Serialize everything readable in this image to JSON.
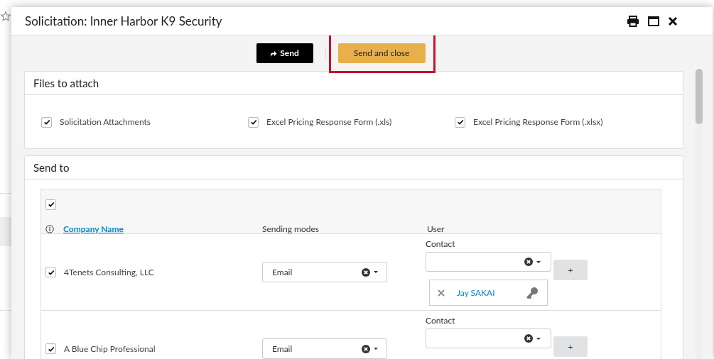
{
  "dialog": {
    "title": "Solicitation: Inner Harbor K9 Security",
    "toolbar": {
      "send": "Send",
      "send_and_close": "Send and close",
      "highlighted": true
    },
    "files_panel": {
      "title": "Files to attach",
      "items": [
        {
          "label": "Solicitation Attachments",
          "checked": true
        },
        {
          "label": "Excel Pricing Response Form (.xls)",
          "checked": true
        },
        {
          "label": "Excel Pricing Response Form (.xlsx)",
          "checked": true
        }
      ]
    },
    "send_to_panel": {
      "title": "Send to",
      "select_all_checked": true,
      "columns": [
        "Company Name",
        "Sending modes",
        "User"
      ],
      "rows": [
        {
          "company": "4Tenets Consulting, LLC",
          "checked": true,
          "sending_mode": "Email",
          "contact_label": "Contact",
          "add": "+",
          "contacts": [
            {
              "name": "Jay SAKAI"
            }
          ]
        },
        {
          "company": "A Blue Chip Professional",
          "checked": true,
          "sending_mode": "Email",
          "contact_label": "Contact",
          "add": "+",
          "contacts": []
        }
      ]
    }
  }
}
